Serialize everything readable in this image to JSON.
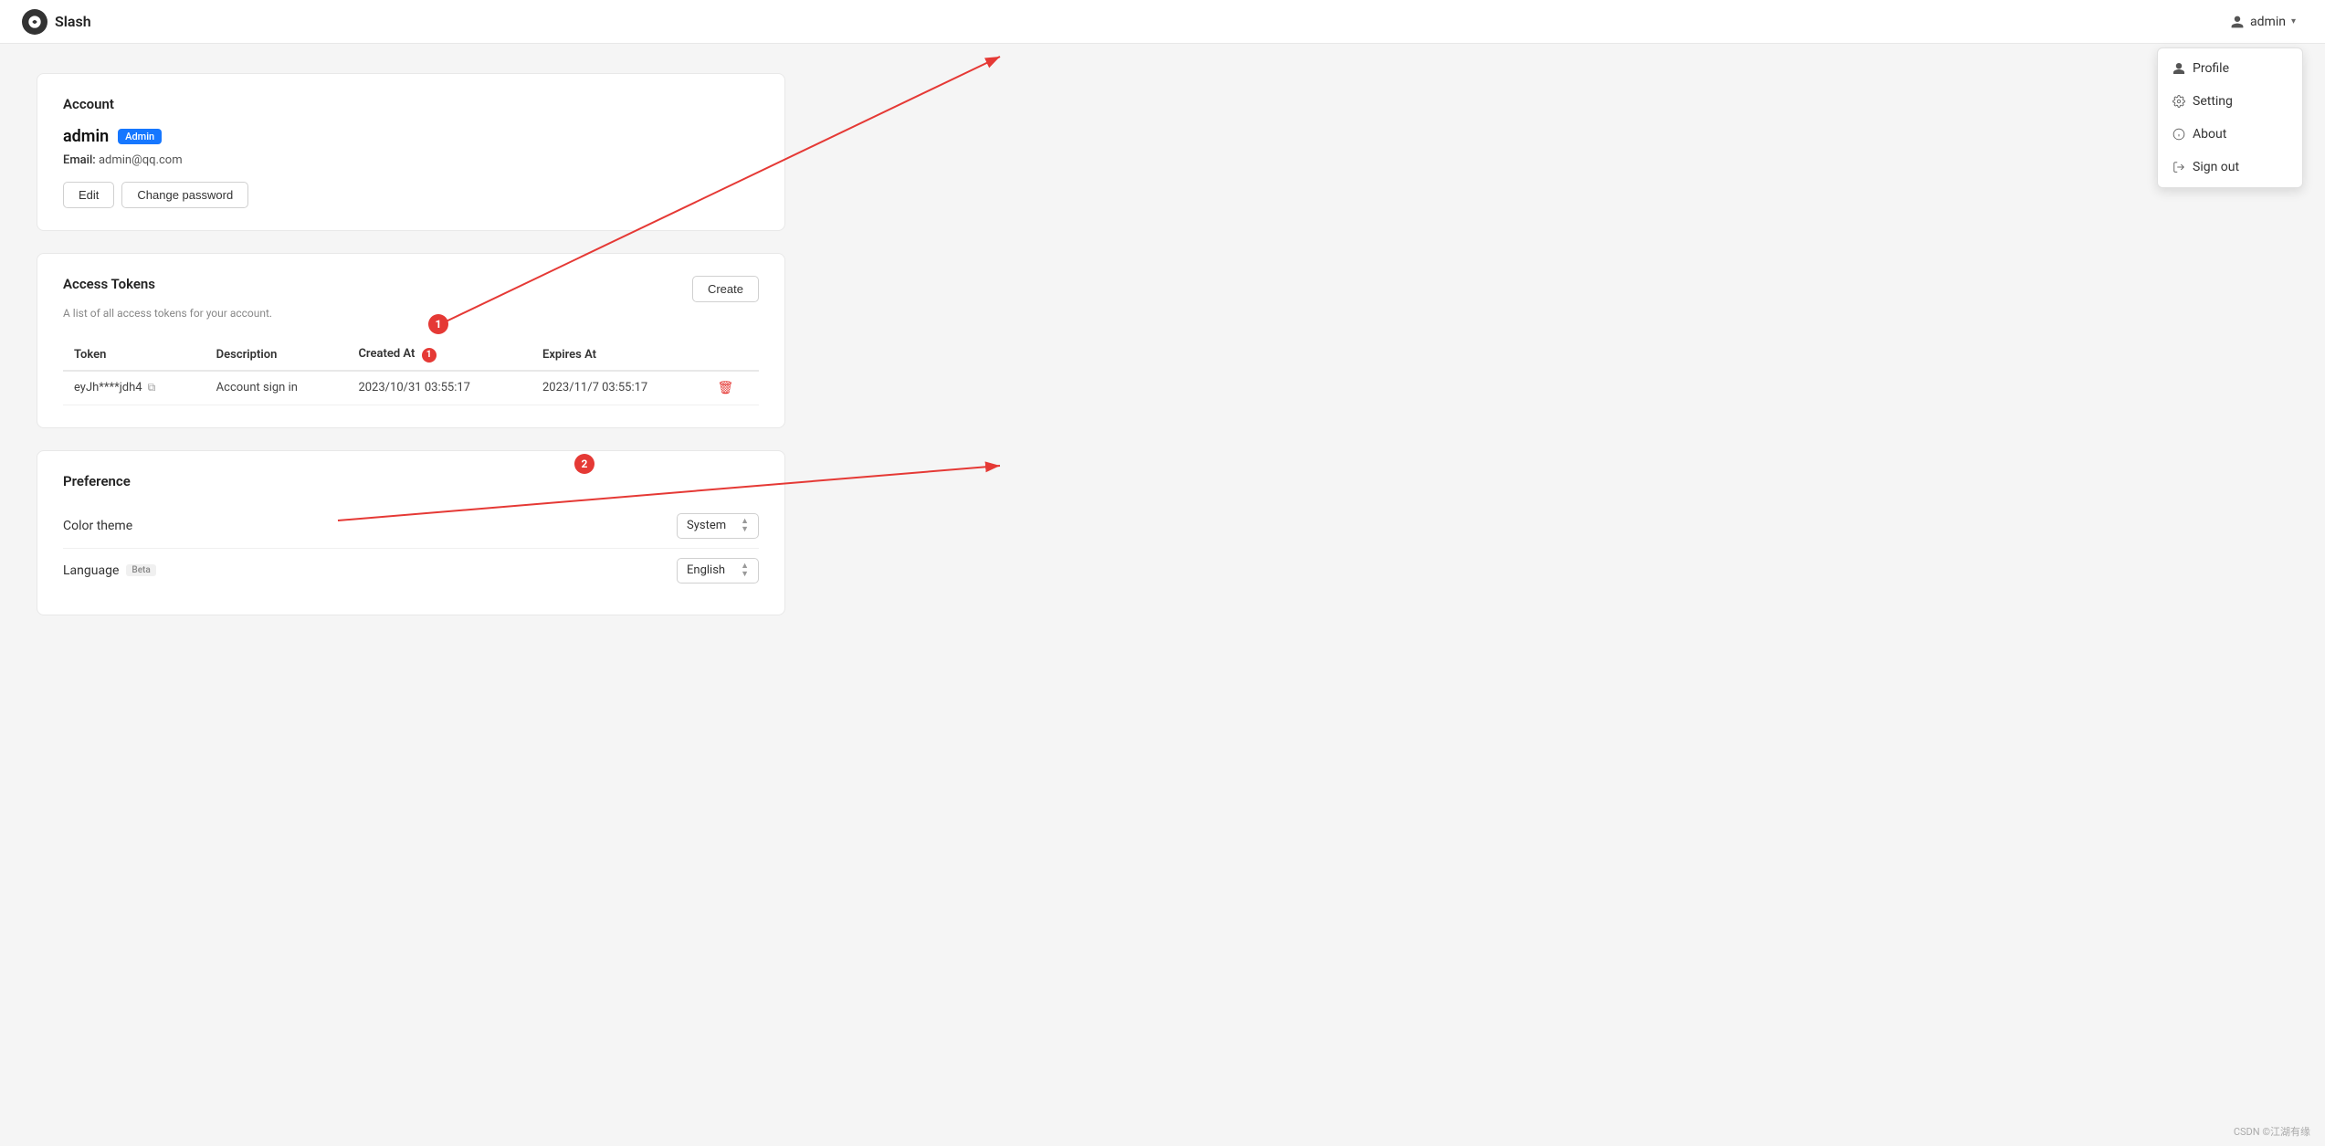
{
  "header": {
    "app_name": "Slash",
    "user_label": "admin",
    "chevron": "▾"
  },
  "dropdown": {
    "items": [
      {
        "id": "profile",
        "label": "Profile",
        "icon": "user"
      },
      {
        "id": "setting",
        "label": "Setting",
        "icon": "gear"
      },
      {
        "id": "about",
        "label": "About",
        "icon": "info"
      },
      {
        "id": "signout",
        "label": "Sign out",
        "icon": "signout"
      }
    ]
  },
  "account": {
    "section_title": "Account",
    "username": "admin",
    "badge": "Admin",
    "email_label": "Email:",
    "email_value": "admin@qq.com",
    "edit_btn": "Edit",
    "change_password_btn": "Change password"
  },
  "access_tokens": {
    "section_title": "Access Tokens",
    "subtitle": "A list of all access tokens for your account.",
    "create_btn": "Create",
    "columns": [
      "Token",
      "Description",
      "Created At",
      "Expires At"
    ],
    "rows": [
      {
        "token": "eyJh****jdh4",
        "description": "Account sign in",
        "created_at": "2023/10/31 03:55:17",
        "expires_at": "2023/11/7 03:55:17"
      }
    ]
  },
  "preference": {
    "section_title": "Preference",
    "color_theme_label": "Color theme",
    "color_theme_value": "System",
    "language_label": "Language",
    "language_beta": "Beta",
    "language_value": "English"
  },
  "footer": {
    "text": "CSDN ©江湖有缘"
  },
  "annotations": {
    "circle1": "1",
    "circle2": "2"
  }
}
